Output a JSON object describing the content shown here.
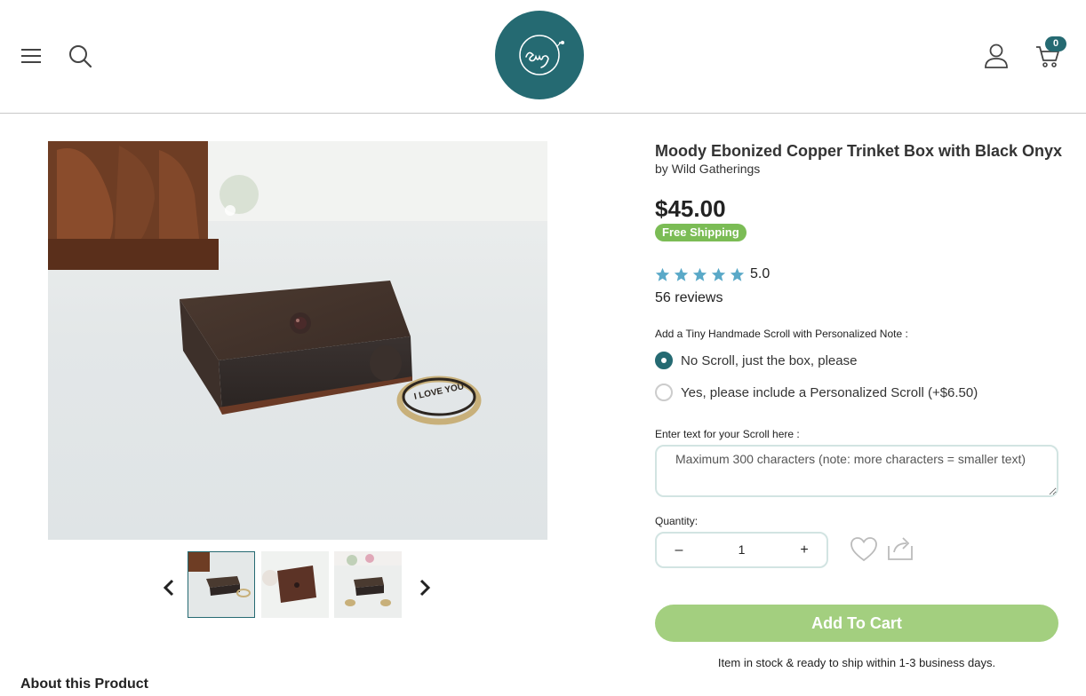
{
  "header": {
    "menu_icon": "hamburger-menu-icon",
    "search_icon": "search-icon",
    "logo_text": "ewg",
    "account_icon": "user-icon",
    "cart_icon": "cart-icon",
    "cart_count": "0",
    "brand_color": "#256a72"
  },
  "gallery": {
    "prev_icon": "chevron-left-icon",
    "next_icon": "chevron-right-icon",
    "thumbnails_count": 3,
    "active_thumbnail": 1
  },
  "product": {
    "title": "Moody Ebonized Copper Trinket Box with Black Onyx",
    "by_prefix": "by ",
    "seller": "Wild Gatherings",
    "price": "$45.00",
    "shipping_badge": "Free Shipping",
    "rating_stars": 5,
    "rating_value": "5.0",
    "reviews": "56 reviews",
    "star_color": "#5aa9c8",
    "badge_color": "#7bbc55"
  },
  "options": {
    "scroll_label": "Add a Tiny Handmade Scroll with Personalized Note :",
    "choices": [
      {
        "label": "No Scroll, just the box, please",
        "selected": true
      },
      {
        "label": "Yes, please include a Personalized Scroll (+$6.50)",
        "selected": false
      }
    ],
    "text_label": "Enter text for your Scroll here :",
    "text_placeholder": "Maximum 300 characters (note: more characters = smaller text)",
    "quantity_label": "Quantity:",
    "quantity_minus": "–",
    "quantity_value": "1",
    "quantity_plus": "+"
  },
  "actions": {
    "favorite_icon": "heart-icon",
    "share_icon": "share-icon",
    "add_to_cart": "Add To Cart",
    "add_to_cart_color": "#a3cf7f",
    "stock_note": "Item in stock & ready to ship within 1-3 business days."
  },
  "about": {
    "title": "About this Product"
  }
}
